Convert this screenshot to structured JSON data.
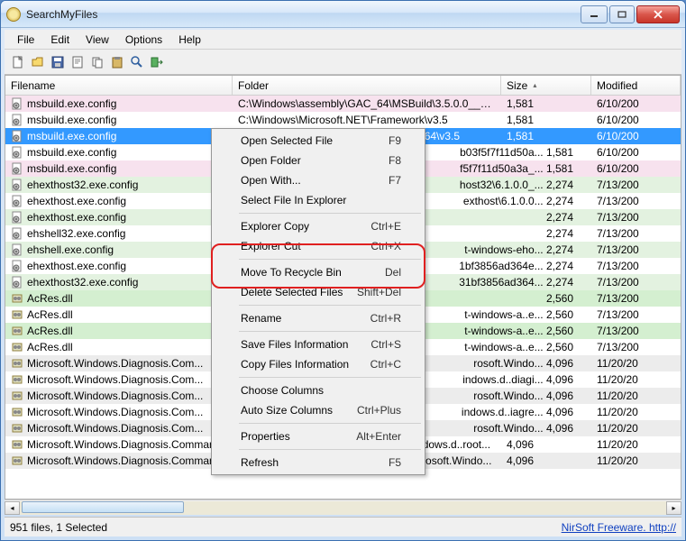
{
  "window": {
    "title": "SearchMyFiles"
  },
  "menu": {
    "items": [
      "File",
      "Edit",
      "View",
      "Options",
      "Help"
    ]
  },
  "columns": {
    "filename": "Filename",
    "folder": "Folder",
    "size": "Size",
    "modified": "Modified"
  },
  "rows": [
    {
      "name": "msbuild.exe.config",
      "folder": "C:\\Windows\\assembly\\GAC_64\\MSBuild\\3.5.0.0__b0...",
      "size": "1,581",
      "mod": "6/10/200",
      "bg": "bg-pink",
      "icon": "config"
    },
    {
      "name": "msbuild.exe.config",
      "folder": "C:\\Windows\\Microsoft.NET\\Framework\\v3.5",
      "size": "1,581",
      "mod": "6/10/200",
      "bg": "bg-white",
      "icon": "config"
    },
    {
      "name": "msbuild.exe.config",
      "folder": "C:\\Windows\\Microsoft.NET\\Framework64\\v3.5",
      "size": "1,581",
      "mod": "6/10/200",
      "bg": "selected",
      "icon": "config"
    },
    {
      "name": "msbuild.exe.config",
      "folder": "",
      "size": "b03f5f7f11d50a...   1,581",
      "mod": "6/10/200",
      "bg": "bg-white",
      "icon": "config"
    },
    {
      "name": "msbuild.exe.config",
      "folder": "",
      "size": "f5f7f11d50a3a_...   1,581",
      "mod": "6/10/200",
      "bg": "bg-pink",
      "icon": "config"
    },
    {
      "name": "ehexthost32.exe.config",
      "folder": "",
      "size": "host32\\6.1.0.0_...   2,274",
      "mod": "7/13/200",
      "bg": "bg-mint",
      "icon": "config"
    },
    {
      "name": "ehexthost.exe.config",
      "folder": "",
      "size": "exthost\\6.1.0.0...   2,274",
      "mod": "7/13/200",
      "bg": "bg-white",
      "icon": "config"
    },
    {
      "name": "ehexthost.exe.config",
      "folder": "",
      "size": "   2,274",
      "mod": "7/13/200",
      "bg": "bg-mint",
      "icon": "config"
    },
    {
      "name": "ehshell32.exe.config",
      "folder": "",
      "size": "   2,274",
      "mod": "7/13/200",
      "bg": "bg-white",
      "icon": "config"
    },
    {
      "name": "ehshell.exe.config",
      "folder": "",
      "size": "t-windows-eho...   2,274",
      "mod": "7/13/200",
      "bg": "bg-mint",
      "icon": "config"
    },
    {
      "name": "ehexthost.exe.config",
      "folder": "",
      "size": "1bf3856ad364e...   2,274",
      "mod": "7/13/200",
      "bg": "bg-white",
      "icon": "config"
    },
    {
      "name": "ehexthost32.exe.config",
      "folder": "",
      "size": "31bf3856ad364...   2,274",
      "mod": "7/13/200",
      "bg": "bg-mint",
      "icon": "config"
    },
    {
      "name": "AcRes.dll",
      "folder": "",
      "size": "   2,560",
      "mod": "7/13/200",
      "bg": "bg-green",
      "icon": "dll"
    },
    {
      "name": "AcRes.dll",
      "folder": "",
      "size": "t-windows-a..e...   2,560",
      "mod": "7/13/200",
      "bg": "bg-white",
      "icon": "dll"
    },
    {
      "name": "AcRes.dll",
      "folder": "",
      "size": "t-windows-a..e...   2,560",
      "mod": "7/13/200",
      "bg": "bg-green",
      "icon": "dll"
    },
    {
      "name": "AcRes.dll",
      "folder": "",
      "size": "t-windows-a..e...   2,560",
      "mod": "7/13/200",
      "bg": "bg-white",
      "icon": "dll"
    },
    {
      "name": "Microsoft.Windows.Diagnosis.Com...",
      "folder": "",
      "size": "rosoft.Windo...   4,096",
      "mod": "11/20/20",
      "bg": "bg-grey",
      "icon": "dll"
    },
    {
      "name": "Microsoft.Windows.Diagnosis.Com...",
      "folder": "",
      "size": "indows.d..diagi...   4,096",
      "mod": "11/20/20",
      "bg": "bg-white",
      "icon": "dll"
    },
    {
      "name": "Microsoft.Windows.Diagnosis.Com...",
      "folder": "",
      "size": "rosoft.Windo...   4,096",
      "mod": "11/20/20",
      "bg": "bg-grey",
      "icon": "dll"
    },
    {
      "name": "Microsoft.Windows.Diagnosis.Com...",
      "folder": "",
      "size": "indows.d..iagre...   4,096",
      "mod": "11/20/20",
      "bg": "bg-white",
      "icon": "dll"
    },
    {
      "name": "Microsoft.Windows.Diagnosis.Com...",
      "folder": "",
      "size": "rosoft.Windo...   4,096",
      "mod": "11/20/20",
      "bg": "bg-grey",
      "icon": "dll"
    },
    {
      "name": "Microsoft.Windows.Diagnosis.Commands...",
      "folder": "C:\\Windows\\winsxs\\msil_microsoft.windows.d..root...",
      "size": "4,096",
      "mod": "11/20/20",
      "bg": "bg-white",
      "icon": "dll"
    },
    {
      "name": "Microsoft.Windows.Diagnosis.Commands...",
      "folder": "C:\\Windows\\assembly\\GAC_MSIL\\Microsoft.Windo...",
      "size": "4,096",
      "mod": "11/20/20",
      "bg": "bg-grey",
      "icon": "dll"
    }
  ],
  "context": {
    "items": [
      {
        "label": "Open Selected File",
        "key": "F9"
      },
      {
        "label": "Open Folder",
        "key": "F8"
      },
      {
        "label": "Open With...",
        "key": "F7"
      },
      {
        "label": "Select File In Explorer",
        "key": ""
      },
      {
        "sep": true
      },
      {
        "label": "Explorer Copy",
        "key": "Ctrl+E"
      },
      {
        "label": "Explorer Cut",
        "key": "Ctrl+X"
      },
      {
        "sep": true
      },
      {
        "label": "Move To Recycle Bin",
        "key": "Del"
      },
      {
        "label": "Delete Selected Files",
        "key": "Shift+Del"
      },
      {
        "sep": true
      },
      {
        "label": "Rename",
        "key": "Ctrl+R"
      },
      {
        "sep": true
      },
      {
        "label": "Save Files Information",
        "key": "Ctrl+S"
      },
      {
        "label": "Copy Files Information",
        "key": "Ctrl+C"
      },
      {
        "sep": true
      },
      {
        "label": "Choose Columns",
        "key": ""
      },
      {
        "label": "Auto Size Columns",
        "key": "Ctrl+Plus"
      },
      {
        "sep": true
      },
      {
        "label": "Properties",
        "key": "Alt+Enter"
      },
      {
        "sep": true
      },
      {
        "label": "Refresh",
        "key": "F5"
      }
    ]
  },
  "status": {
    "left": "951 files, 1 Selected",
    "right": "NirSoft Freeware.  http://"
  }
}
